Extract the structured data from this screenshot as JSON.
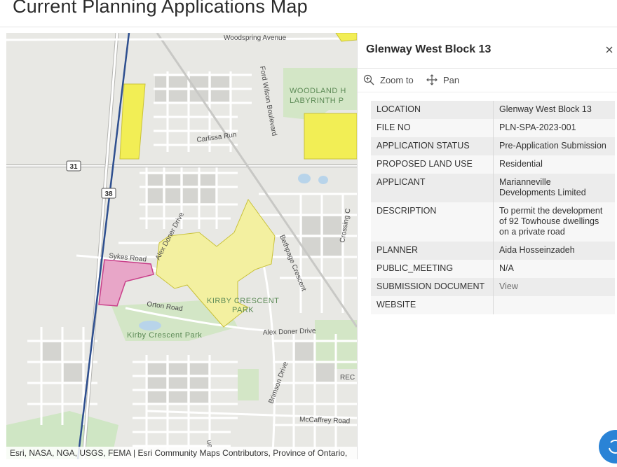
{
  "app": {
    "title": "Current Planning Applications Map"
  },
  "map": {
    "attribution": "Esri, NASA, NGA, USGS, FEMA | Esri Community Maps Contributors, Province of Ontario,",
    "road_labels": {
      "woodspring": "Woodspring Avenue",
      "ford_wilson": "Ford Wilson Boulevard",
      "carlissa": "Carlissa Run",
      "sykes": "Sykes Road",
      "alex_doner_1": "Alex Doner Drive",
      "alex_doner_2": "Alex Doner Drive",
      "bethpage": "Bethpage Crescent",
      "crossing": "Crossing C",
      "orton": "Orton Road",
      "brimson": "Brimson Drive",
      "mccaffrey": "McCaffrey Road",
      "bottom_road": "ue"
    },
    "route_shields": {
      "r31": "31",
      "r38": "38"
    },
    "place_labels": {
      "woodland_1": "WOODLAND H",
      "woodland_2": "LABYRINTH P",
      "kirby_1": "KIRBY CRESCENT",
      "kirby_2": "PARK",
      "kirby_park": "Kirby Crescent Park",
      "rec": "REC"
    },
    "colors": {
      "application_area": "#f2ee55",
      "selected_application": "#e8a6c8",
      "park": "#cfe3c0",
      "boundary_line": "#2e4f8f"
    }
  },
  "popup": {
    "title": "Glenway West Block 13",
    "actions": {
      "zoom_to": "Zoom to",
      "pan": "Pan"
    },
    "attributes": [
      {
        "label": "LOCATION",
        "value": "Glenway West Block 13"
      },
      {
        "label": "FILE NO",
        "value": "PLN-SPA-2023-001"
      },
      {
        "label": "APPLICATION STATUS",
        "value": "Pre-Application Submission"
      },
      {
        "label": "PROPOSED LAND USE",
        "value": "Residential"
      },
      {
        "label": "APPLICANT",
        "value": "Marianneville Developments Limited"
      },
      {
        "label": "DESCRIPTION",
        "value": "To permit the development of 92 Towhouse dwellings on a private road"
      },
      {
        "label": "PLANNER",
        "value": "Aida Hosseinzadeh"
      },
      {
        "label": "PUBLIC_MEETING",
        "value": "N/A"
      },
      {
        "label": "SUBMISSION DOCUMENT",
        "value": "View"
      },
      {
        "label": "WEBSITE",
        "value": ""
      }
    ]
  }
}
